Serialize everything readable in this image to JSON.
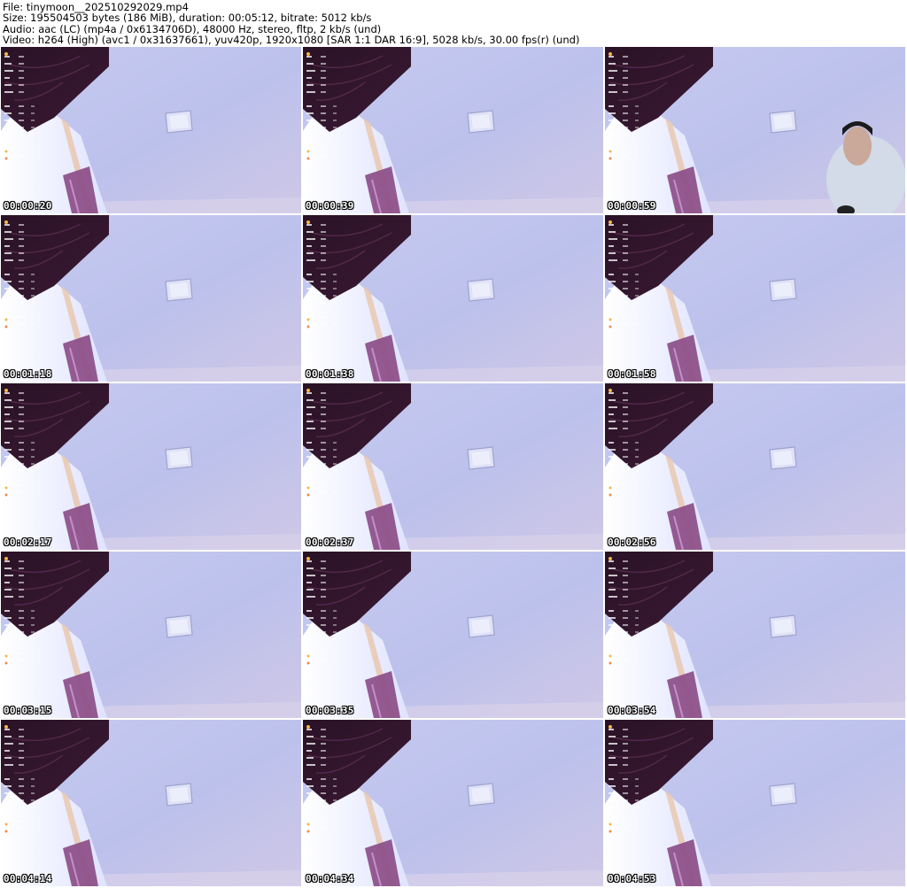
{
  "file_info": {
    "file_line": "File: tinymoon__202510292029.mp4",
    "size_line": "Size: 195504503 bytes (186 MiB), duration: 00:05:12, bitrate: 5012 kb/s",
    "audio_line": "Audio: aac (LC) (mp4a / 0x6134706D), 48000 Hz, stereo, fltp, 2 kb/s (und)",
    "video_line": "Video: h264 (High) (avc1 / 0x31637661), yuv420p, 1920x1080 [SAR 1:1 DAR 16:9], 5028 kb/s, 30.00 fps(r) (und)"
  },
  "thumbnails": [
    {
      "timestamp": "00:00:20",
      "person_visible": false
    },
    {
      "timestamp": "00:00:39",
      "person_visible": false
    },
    {
      "timestamp": "00:00:59",
      "person_visible": true
    },
    {
      "timestamp": "00:01:18",
      "person_visible": false
    },
    {
      "timestamp": "00:01:38",
      "person_visible": false
    },
    {
      "timestamp": "00:01:58",
      "person_visible": false
    },
    {
      "timestamp": "00:02:17",
      "person_visible": false
    },
    {
      "timestamp": "00:02:37",
      "person_visible": false
    },
    {
      "timestamp": "00:02:56",
      "person_visible": false
    },
    {
      "timestamp": "00:03:15",
      "person_visible": false
    },
    {
      "timestamp": "00:03:35",
      "person_visible": false
    },
    {
      "timestamp": "00:03:54",
      "person_visible": false
    },
    {
      "timestamp": "00:04:14",
      "person_visible": false
    },
    {
      "timestamp": "00:04:34",
      "person_visible": false
    },
    {
      "timestamp": "00:04:53",
      "person_visible": false
    }
  ],
  "colors": {
    "wall": "#bcc1ec",
    "beam": "#3a1a34",
    "window": "#f4f4ff",
    "curtain": "#8a4a86",
    "timestamp_text": "#ffffff"
  }
}
